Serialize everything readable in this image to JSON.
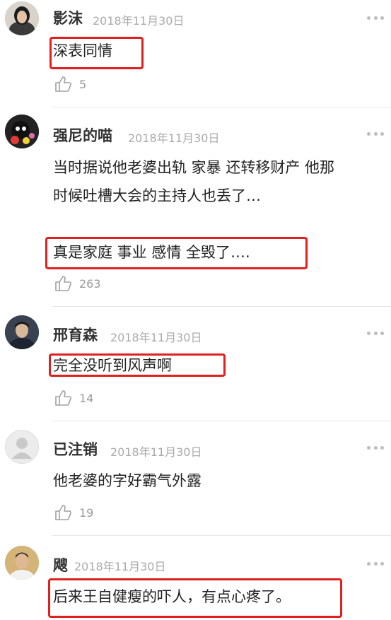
{
  "comments": [
    {
      "username": "影沫",
      "date": "2018年11月30日",
      "lines": [
        "深表同情"
      ],
      "likes": "5",
      "avatar": "woman-photo-avatar"
    },
    {
      "username": "强尼的喵",
      "date": "2018年11月30日",
      "lines": [
        "当时据说他老婆出轨 家暴 还转移财产 他那",
        "时候吐槽大会的主持人也丢了…",
        "真是家庭 事业 感情 全毁了…."
      ],
      "likes": "263",
      "avatar": "character-with-flowers-avatar"
    },
    {
      "username": "邢育森",
      "date": "2018年11月30日",
      "lines": [
        "完全没听到风声啊"
      ],
      "likes": "14",
      "avatar": "man-photo-avatar"
    },
    {
      "username": "已注销",
      "date": "2018年11月30日",
      "lines": [
        "他老婆的字好霸气外露"
      ],
      "likes": "19",
      "avatar": "default-user-avatar"
    },
    {
      "username": "飕",
      "date": "2018年11月30日",
      "lines": [
        "后来王自健瘦的吓人，有点心疼了。"
      ],
      "likes": "",
      "avatar": "man-selfie-avatar"
    }
  ],
  "colors": {
    "highlight": "#e0201f",
    "username": "#333333",
    "date": "#aaaaaa",
    "text": "#222222",
    "divider": "#e8e8e8"
  }
}
